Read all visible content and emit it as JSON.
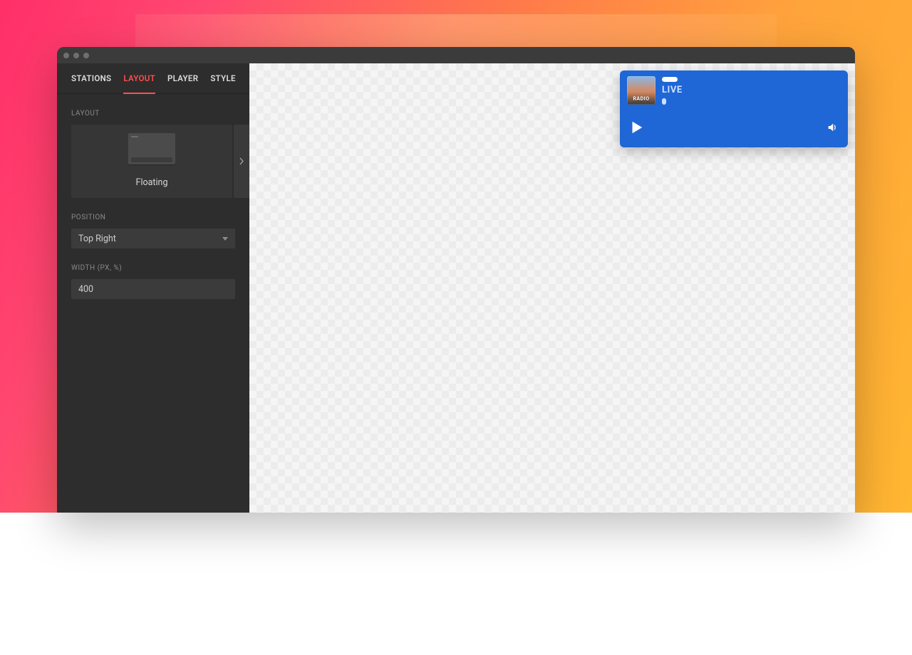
{
  "tabs": [
    "STATIONS",
    "LAYOUT",
    "PLAYER",
    "STYLE"
  ],
  "active_tab": "LAYOUT",
  "sections": {
    "layout_label": "LAYOUT",
    "layout_option": "Floating",
    "position_label": "POSITION",
    "position_value": "Top Right",
    "width_label": "WIDTH (PX, %)",
    "width_value": "400"
  },
  "player": {
    "status": "LIVE",
    "artwork_label": "RADIO"
  }
}
